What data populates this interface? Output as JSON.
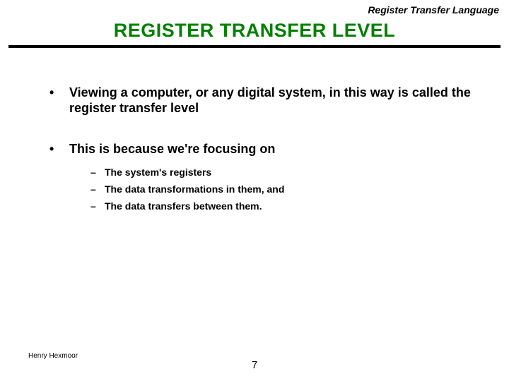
{
  "header": {
    "topic": "Register Transfer Language",
    "title": "REGISTER  TRANSFER LEVEL"
  },
  "body": {
    "bullets": [
      {
        "marker": "•",
        "text": "Viewing a computer, or any digital system, in this way is called the register transfer level"
      },
      {
        "marker": "•",
        "text": "This is because we're focusing on"
      }
    ],
    "subbullets": [
      {
        "marker": "–",
        "text": "The system's registers"
      },
      {
        "marker": "–",
        "text": "The data transformations in them, and"
      },
      {
        "marker": "–",
        "text": "The data transfers between them."
      }
    ]
  },
  "footer": {
    "author": "Henry Hexmoor",
    "page": "7"
  }
}
